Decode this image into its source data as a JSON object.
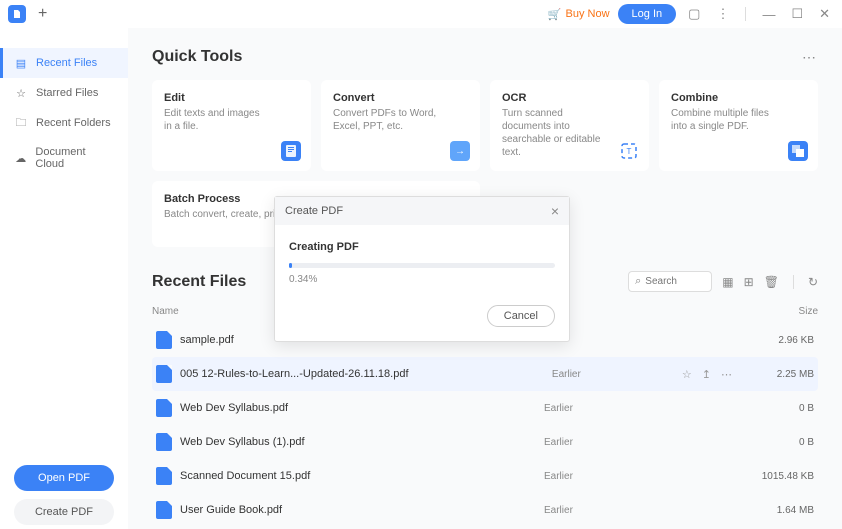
{
  "titlebar": {
    "buy_now": "Buy Now",
    "login": "Log In"
  },
  "sidebar": {
    "items": [
      {
        "label": "Recent Files"
      },
      {
        "label": "Starred Files"
      },
      {
        "label": "Recent Folders"
      },
      {
        "label": "Document Cloud"
      }
    ],
    "open_pdf": "Open PDF",
    "create_pdf": "Create PDF"
  },
  "quick_tools": {
    "title": "Quick Tools",
    "cards": [
      {
        "title": "Edit",
        "desc": "Edit texts and images in a file."
      },
      {
        "title": "Convert",
        "desc": "Convert PDFs to Word, Excel, PPT, etc."
      },
      {
        "title": "OCR",
        "desc": "Turn scanned documents into searchable or editable text."
      },
      {
        "title": "Combine",
        "desc": "Combine multiple files into a single PDF."
      },
      {
        "title": "Batch Process",
        "desc": "Batch convert, create, print, OCR PDFs, etc."
      }
    ]
  },
  "recent": {
    "title": "Recent Files",
    "search_placeholder": "Search",
    "columns": {
      "name": "Name",
      "size": "Size"
    },
    "files": [
      {
        "name": "sample.pdf",
        "date": "",
        "size": "2.96 KB"
      },
      {
        "name": "005  12-Rules-to-Learn...-Updated-26.11.18.pdf",
        "date": "Earlier",
        "size": "2.25 MB"
      },
      {
        "name": "Web Dev Syllabus.pdf",
        "date": "Earlier",
        "size": "0 B"
      },
      {
        "name": "Web Dev Syllabus (1).pdf",
        "date": "Earlier",
        "size": "0 B"
      },
      {
        "name": "Scanned Document 15.pdf",
        "date": "Earlier",
        "size": "1015.48 KB"
      },
      {
        "name": "User Guide Book.pdf",
        "date": "Earlier",
        "size": "1.64 MB"
      }
    ]
  },
  "modal": {
    "header": "Create PDF",
    "title": "Creating PDF",
    "progress": "0.34%",
    "cancel": "Cancel"
  }
}
